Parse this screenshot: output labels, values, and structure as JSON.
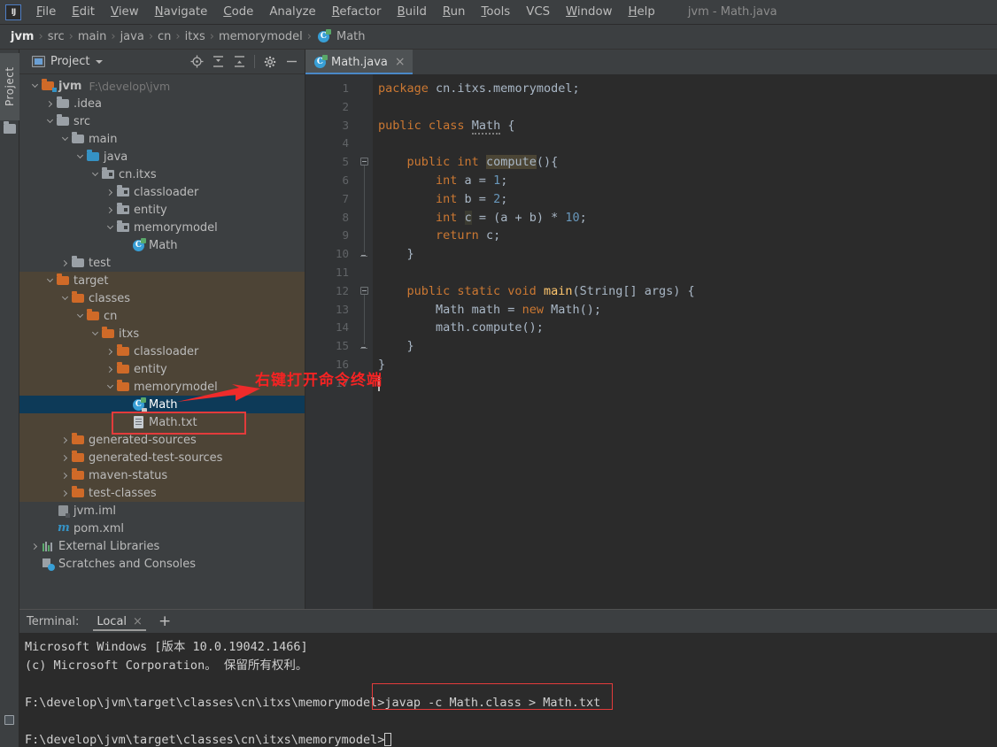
{
  "window": {
    "title": "jvm - Math.java"
  },
  "menu": {
    "items": [
      {
        "label": "File",
        "mnemonic": "F"
      },
      {
        "label": "Edit",
        "mnemonic": "E"
      },
      {
        "label": "View",
        "mnemonic": "V"
      },
      {
        "label": "Navigate",
        "mnemonic": "N"
      },
      {
        "label": "Code",
        "mnemonic": "C"
      },
      {
        "label": "Analyze",
        "mnemonic": ""
      },
      {
        "label": "Refactor",
        "mnemonic": "R"
      },
      {
        "label": "Build",
        "mnemonic": "B"
      },
      {
        "label": "Run",
        "mnemonic": "R"
      },
      {
        "label": "Tools",
        "mnemonic": "T"
      },
      {
        "label": "VCS",
        "mnemonic": ""
      },
      {
        "label": "Window",
        "mnemonic": "W"
      },
      {
        "label": "Help",
        "mnemonic": "H"
      }
    ]
  },
  "breadcrumb": {
    "items": [
      "jvm",
      "src",
      "main",
      "java",
      "cn",
      "itxs",
      "memorymodel",
      "Math"
    ],
    "separator": "›"
  },
  "left_strip": {
    "project_tab": "Project"
  },
  "project_panel": {
    "title": "Project",
    "tools": [
      "locate-icon",
      "expand-all-icon",
      "collapse-all-icon",
      "settings-gear-icon",
      "hide-icon"
    ],
    "tree": [
      {
        "depth": 0,
        "label": "jvm",
        "note": "F:\\develop\\jvm",
        "icon": "module-folder",
        "arrow": "down",
        "bold": true
      },
      {
        "depth": 1,
        "label": ".idea",
        "note": "",
        "icon": "folder-gray",
        "arrow": "right"
      },
      {
        "depth": 1,
        "label": "src",
        "note": "",
        "icon": "folder-gray",
        "arrow": "down"
      },
      {
        "depth": 2,
        "label": "main",
        "note": "",
        "icon": "folder-gray",
        "arrow": "down"
      },
      {
        "depth": 3,
        "label": "java",
        "note": "",
        "icon": "folder-blue",
        "arrow": "down"
      },
      {
        "depth": 4,
        "label": "cn.itxs",
        "note": "",
        "icon": "package",
        "arrow": "down"
      },
      {
        "depth": 5,
        "label": "classloader",
        "note": "",
        "icon": "package",
        "arrow": "right"
      },
      {
        "depth": 5,
        "label": "entity",
        "note": "",
        "icon": "package",
        "arrow": "right"
      },
      {
        "depth": 5,
        "label": "memorymodel",
        "note": "",
        "icon": "package",
        "arrow": "down"
      },
      {
        "depth": 6,
        "label": "Math",
        "note": "",
        "icon": "java-class",
        "arrow": ""
      },
      {
        "depth": 2,
        "label": "test",
        "note": "",
        "icon": "folder-gray",
        "arrow": "right"
      },
      {
        "depth": 1,
        "label": "target",
        "note": "",
        "icon": "folder-orange",
        "arrow": "down",
        "highlight": true
      },
      {
        "depth": 2,
        "label": "classes",
        "note": "",
        "icon": "folder-orange",
        "arrow": "down",
        "highlight": true
      },
      {
        "depth": 3,
        "label": "cn",
        "note": "",
        "icon": "folder-orange",
        "arrow": "down",
        "highlight": true
      },
      {
        "depth": 4,
        "label": "itxs",
        "note": "",
        "icon": "folder-orange",
        "arrow": "down",
        "highlight": true
      },
      {
        "depth": 5,
        "label": "classloader",
        "note": "",
        "icon": "folder-orange",
        "arrow": "right",
        "highlight": true
      },
      {
        "depth": 5,
        "label": "entity",
        "note": "",
        "icon": "folder-orange",
        "arrow": "right",
        "highlight": true
      },
      {
        "depth": 5,
        "label": "memorymodel",
        "note": "",
        "icon": "folder-orange",
        "arrow": "down",
        "highlight": true
      },
      {
        "depth": 6,
        "label": "Math",
        "note": "",
        "icon": "compiled-class",
        "arrow": "",
        "selected": true
      },
      {
        "depth": 6,
        "label": "Math.txt",
        "note": "",
        "icon": "text-file",
        "arrow": "",
        "highlight": true
      },
      {
        "depth": 2,
        "label": "generated-sources",
        "note": "",
        "icon": "folder-orange",
        "arrow": "right",
        "highlight": true
      },
      {
        "depth": 2,
        "label": "generated-test-sources",
        "note": "",
        "icon": "folder-orange",
        "arrow": "right",
        "highlight": true
      },
      {
        "depth": 2,
        "label": "maven-status",
        "note": "",
        "icon": "folder-orange",
        "arrow": "right",
        "highlight": true
      },
      {
        "depth": 2,
        "label": "test-classes",
        "note": "",
        "icon": "folder-orange",
        "arrow": "right",
        "highlight": true
      },
      {
        "depth": 1,
        "label": "jvm.iml",
        "note": "",
        "icon": "iml-file",
        "arrow": ""
      },
      {
        "depth": 1,
        "label": "pom.xml",
        "note": "",
        "icon": "maven-file",
        "arrow": ""
      },
      {
        "depth": 0,
        "label": "External Libraries",
        "note": "",
        "icon": "libraries",
        "arrow": "right"
      },
      {
        "depth": 0,
        "label": "Scratches and Consoles",
        "note": "",
        "icon": "scratches",
        "arrow": ""
      }
    ]
  },
  "editor": {
    "tab": {
      "label": "Math.java",
      "close": "×"
    },
    "lines": [
      {
        "n": "1",
        "run": false,
        "html": "<span class=\"kw\">package</span> cn.itxs.memorymodel;"
      },
      {
        "n": "2",
        "run": false,
        "html": ""
      },
      {
        "n": "3",
        "run": true,
        "html": "<span class=\"kw\">public class</span> <span class=\"squig\">Math</span> {"
      },
      {
        "n": "4",
        "run": false,
        "html": ""
      },
      {
        "n": "5",
        "run": false,
        "html": "    <span class=\"kw\">public int</span> <span class=\"hl-ident\">compute</span>(){"
      },
      {
        "n": "6",
        "run": false,
        "html": "        <span class=\"kw\">int</span> a = <span class=\"num\">1</span>;"
      },
      {
        "n": "7",
        "run": false,
        "html": "        <span class=\"kw\">int</span> b = <span class=\"num\">2</span>;"
      },
      {
        "n": "8",
        "run": false,
        "html": "        <span class=\"kw\">int</span> <span class=\"hl-soft\">c</span> = (a + b) * <span class=\"num\">10</span>;"
      },
      {
        "n": "9",
        "run": false,
        "html": "        <span class=\"kw\">return</span> c;"
      },
      {
        "n": "10",
        "run": false,
        "html": "    }"
      },
      {
        "n": "11",
        "run": false,
        "html": ""
      },
      {
        "n": "12",
        "run": true,
        "html": "    <span class=\"kw\">public static void</span> <span class=\"mth\">main</span>(String[] args) {"
      },
      {
        "n": "13",
        "run": false,
        "html": "        Math math = <span class=\"kw\">new</span> Math();"
      },
      {
        "n": "14",
        "run": false,
        "html": "        math.compute();"
      },
      {
        "n": "15",
        "run": false,
        "html": "    }"
      },
      {
        "n": "16",
        "run": false,
        "html": "}"
      },
      {
        "n": "17",
        "run": false,
        "html": ""
      }
    ],
    "plain_text": [
      "package cn.itxs.memorymodel;",
      "",
      "public class Math {",
      "",
      "    public int compute(){",
      "        int a = 1;",
      "        int b = 2;",
      "        int c = (a + b) * 10;",
      "        return c;",
      "    }",
      "",
      "    public static void main(String[] args) {",
      "        Math math = new Math();",
      "        math.compute();",
      "    }",
      "}",
      ""
    ]
  },
  "annotation": {
    "text": "右键打开命令终端",
    "color": "#f52323"
  },
  "terminal": {
    "label": "Terminal:",
    "tab": "Local",
    "tab_close": "×",
    "add": "+",
    "lines": [
      "Microsoft Windows [版本 10.0.19042.1466]",
      "(c) Microsoft Corporation。 保留所有权利。",
      "",
      "F:\\develop\\jvm\\target\\classes\\cn\\itxs\\memorymodel>",
      "",
      "F:\\develop\\jvm\\target\\classes\\cn\\itxs\\memorymodel>"
    ],
    "command": "javap -c Math.class > Math.txt",
    "prompt": "F:\\develop\\jvm\\target\\classes\\cn\\itxs\\memorymodel>"
  },
  "colors": {
    "accent_blue": "#4a88c7",
    "selection_blue": "#0d3a58",
    "target_highlight": "#4d4436",
    "annotation_red": "#e33b3b",
    "keyword_orange": "#cc7832",
    "number_blue": "#6897bb",
    "method_yellow": "#ffc66d"
  }
}
